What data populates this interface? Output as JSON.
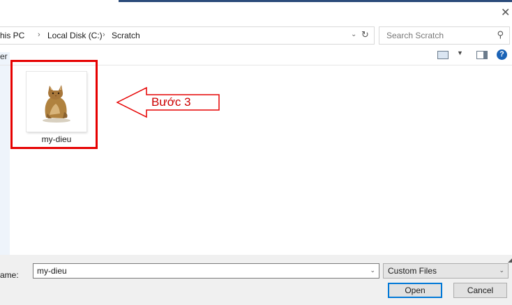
{
  "window": {
    "close_glyph": "✕"
  },
  "address": {
    "crumbs": [
      "his PC",
      "Local Disk (C:)",
      "Scratch"
    ],
    "separator": "›"
  },
  "search": {
    "placeholder": "Search Scratch"
  },
  "toolbar": {
    "partial_label": "er"
  },
  "files": [
    {
      "name": "my-dieu",
      "thumbnail": "cat-image"
    }
  ],
  "annotation": {
    "label": "Bước 3",
    "color": "#e60000"
  },
  "footer": {
    "filename_label": "ame:",
    "filename_value": "my-dieu",
    "filetype_value": "Custom Files",
    "open_label": "Open",
    "cancel_label": "Cancel"
  }
}
